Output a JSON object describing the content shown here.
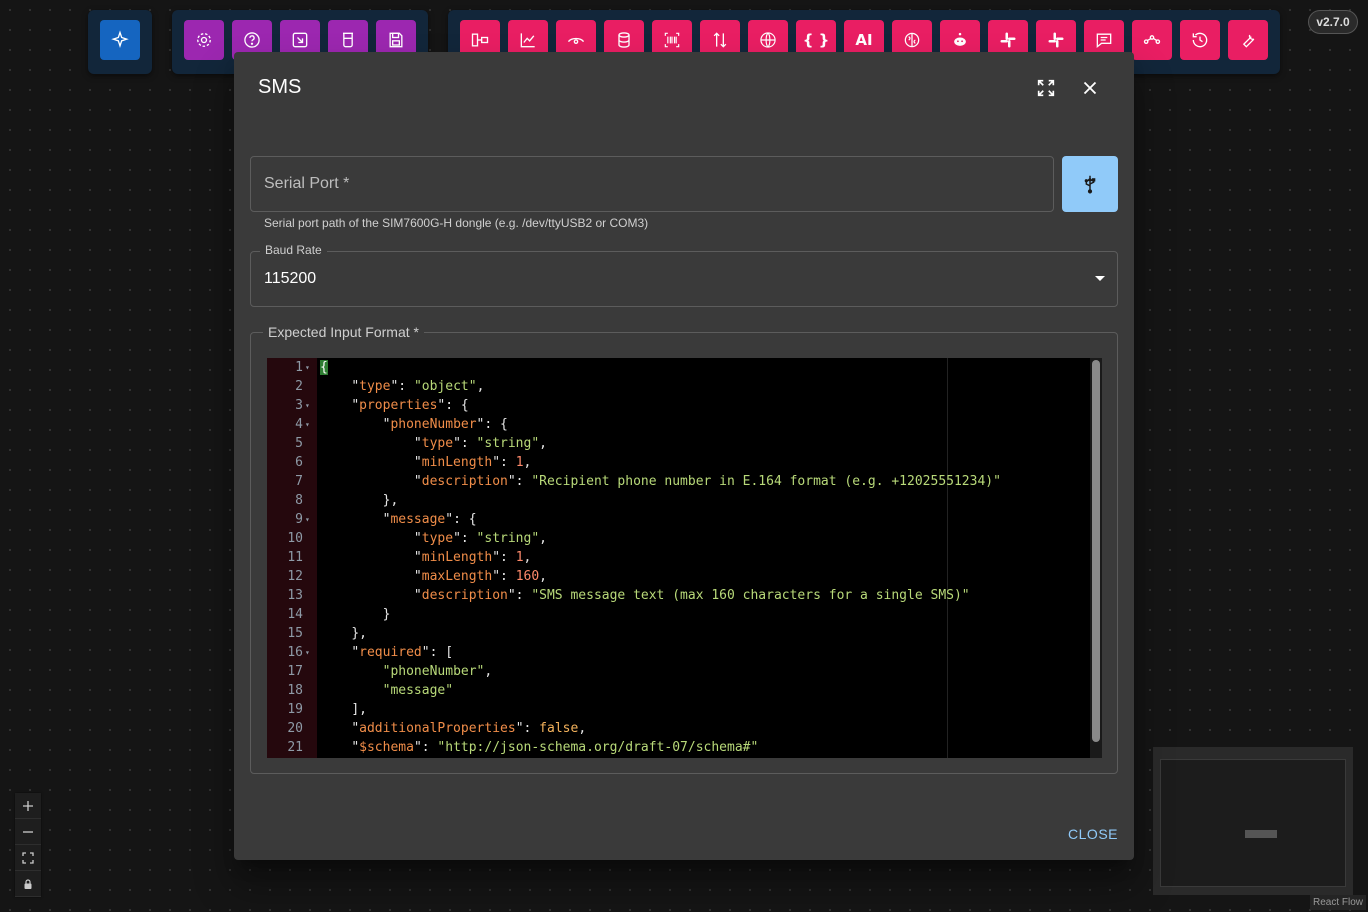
{
  "toolbar": {
    "group1": [
      {
        "icon": "sparkle-icon",
        "color": "#1565c0"
      }
    ],
    "group2": [
      {
        "icon": "gear-icon"
      },
      {
        "icon": "help-icon"
      },
      {
        "icon": "import-icon"
      },
      {
        "icon": "beaker-icon"
      },
      {
        "icon": "save-icon"
      }
    ],
    "group3": [
      {
        "icon": "flow-node-icon"
      },
      {
        "icon": "line-chart-icon"
      },
      {
        "icon": "eye-icon"
      },
      {
        "icon": "database-icon"
      },
      {
        "icon": "barcode-icon"
      },
      {
        "icon": "sort-arrows-icon"
      },
      {
        "icon": "www-icon"
      },
      {
        "icon": "curly-braces-icon",
        "text": "{ }"
      },
      {
        "icon": "ai-icon",
        "text": "AI"
      },
      {
        "icon": "brain-icon"
      },
      {
        "icon": "reddit-icon"
      },
      {
        "icon": "slack-icon"
      },
      {
        "icon": "slack-alt-icon"
      },
      {
        "icon": "chat-icon"
      },
      {
        "icon": "graph-icon"
      },
      {
        "icon": "history-icon"
      },
      {
        "icon": "ai-wrench-icon"
      }
    ],
    "colors": {
      "purple": "#9c27b0",
      "pink": "#e91e63",
      "blue": "#1565c0"
    }
  },
  "version": "v2.7.0",
  "dialog": {
    "title": "SMS",
    "serial_port_label": "Serial Port *",
    "serial_port_value": "",
    "serial_port_helper": "Serial port path of the SIM7600G-H dongle (e.g. /dev/ttyUSB2 or COM3)",
    "baud_rate_label": "Baud Rate",
    "baud_rate_value": "115200",
    "format_label": "Expected Input Format *",
    "close_label": "CLOSE",
    "editor_lines": [
      "{",
      "    \"type\": \"object\",",
      "    \"properties\": {",
      "        \"phoneNumber\": {",
      "            \"type\": \"string\",",
      "            \"minLength\": 1,",
      "            \"description\": \"Recipient phone number in E.164 format (e.g. +12025551234)\"",
      "        },",
      "        \"message\": {",
      "            \"type\": \"string\",",
      "            \"minLength\": 1,",
      "            \"maxLength\": 160,",
      "            \"description\": \"SMS message text (max 160 characters for a single SMS)\"",
      "        }",
      "    },",
      "    \"required\": [",
      "        \"phoneNumber\",",
      "        \"message\"",
      "    ],",
      "    \"additionalProperties\": false,",
      "    \"$schema\": \"http://json-schema.org/draft-07/schema#\""
    ],
    "fold_lines": [
      1,
      3,
      4,
      9,
      16
    ]
  },
  "zoom_controls": [
    "zoom-in",
    "zoom-out",
    "fit-view",
    "lock"
  ],
  "attribution": "React Flow"
}
